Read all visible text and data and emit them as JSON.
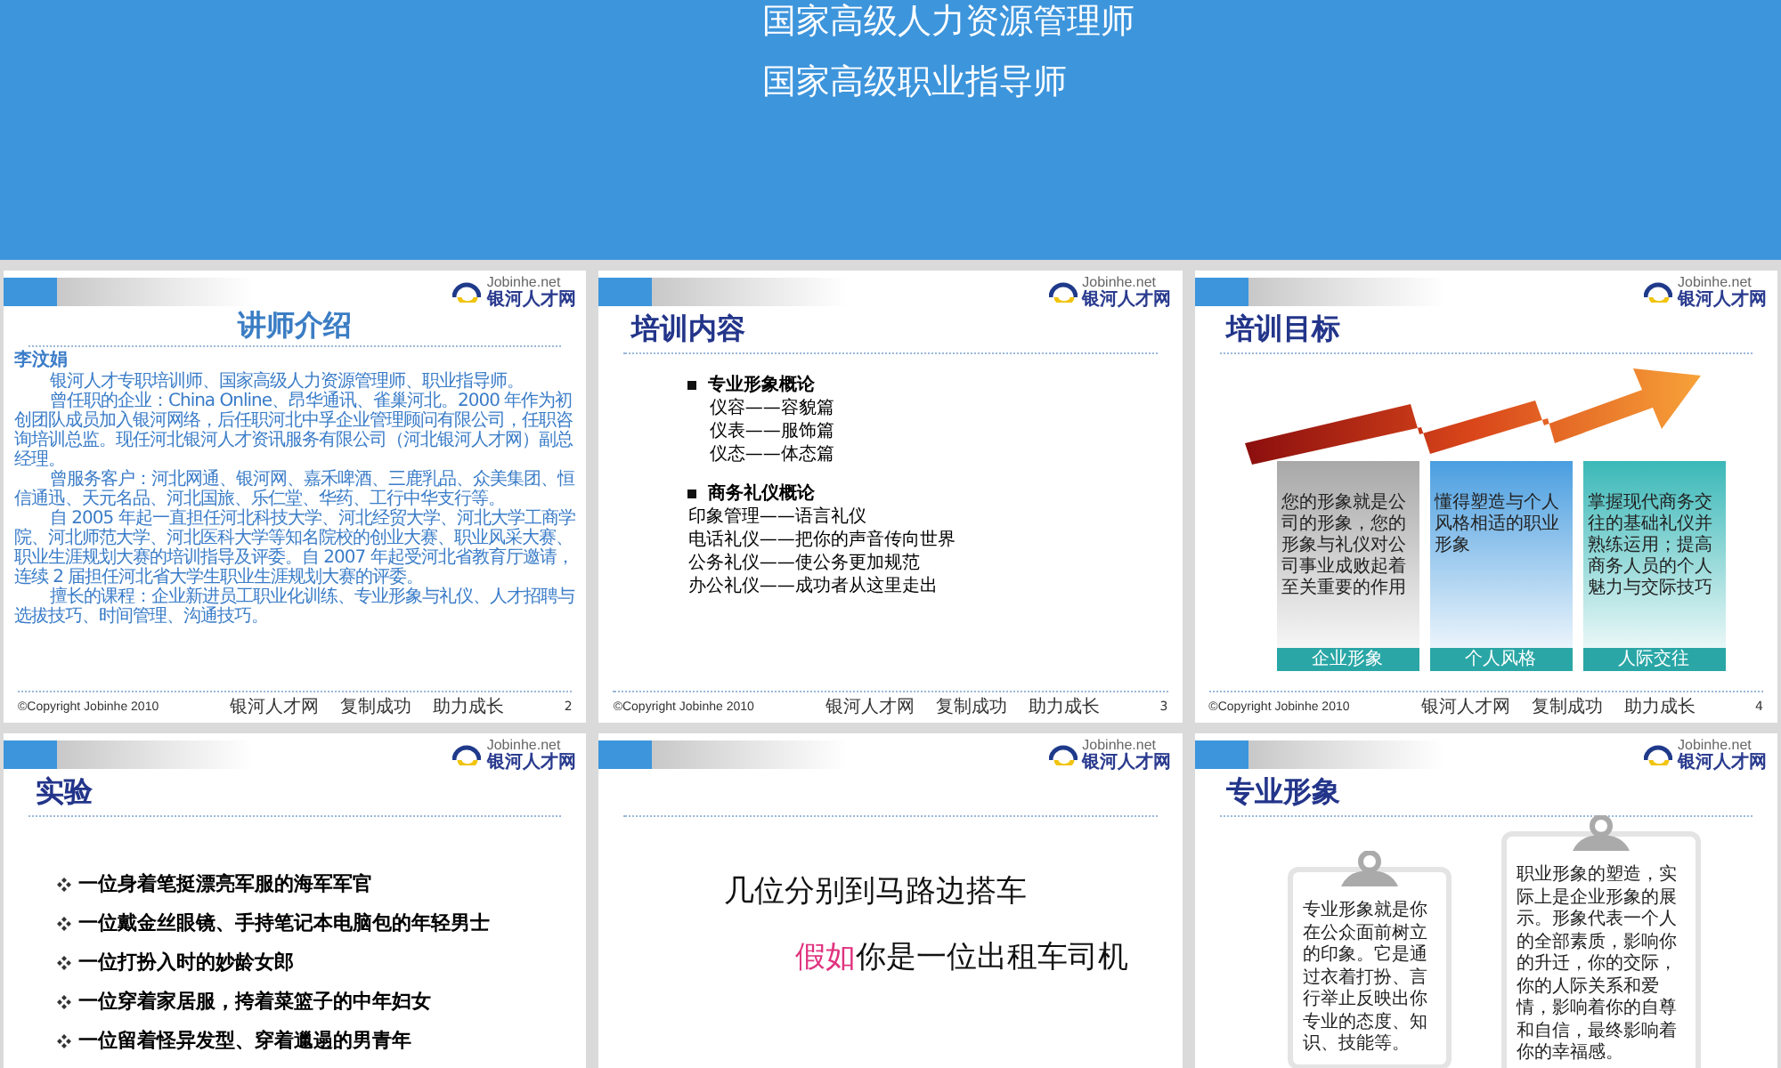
{
  "top_slide": {
    "lines": [
      "国家高级人力资源管理师",
      "国家高级职业指导师"
    ]
  },
  "slides": [
    {
      "kind": "bio",
      "title": "讲师介绍",
      "logo": {
        "brand": "Jobinhe.net",
        "name": "银河人才网"
      },
      "name": "李汶娟",
      "paragraphs": [
        "银河人才专职培训师、国家高级人力资源管理师、职业指导师。",
        "曾任职的企业：China Online、昂华通讯、雀巢河北。2000 年作为初创团队成员加入银河网络，后任职河北中孚企业管理顾问有限公司，任职咨询培训总监。现任河北银河人才资讯服务有限公司（河北银河人才网）副总经理。",
        "曾服务客户：河北网通、银河网、嘉禾啤酒、三鹿乳品、众美集团、恒信通迅、天元名品、河北国旅、乐仁堂、华药、工行中华支行等。",
        "自 2005 年起一直担任河北科技大学、河北经贸大学、河北大学工商学院、河北师范大学、河北医科大学等知名院校的创业大赛、职业风采大赛、职业生涯规划大赛的培训指导及评委。自 2007 年起受河北省教育厅邀请，连续 2 届担任河北省大学生职业生涯规划大赛的评委。",
        "擅长的课程：企业新进员工职业化训练、专业形象与礼仪、人才招聘与选拔技巧、时间管理、沟通技巧。"
      ],
      "footer": {
        "copyright": "©Copyright  Jobinhe  2010",
        "slogans": [
          "银河人才网",
          "复制成功",
          "助力成长"
        ],
        "page": "2"
      }
    },
    {
      "kind": "outline",
      "title": "培训内容",
      "logo": {
        "brand": "Jobinhe.net",
        "name": "银河人才网"
      },
      "sections": [
        {
          "heading": "专业形象概论",
          "items": [
            "仪容——容貌篇",
            "仪表——服饰篇",
            "仪态——体态篇"
          ]
        },
        {
          "heading": "商务礼仪概论",
          "items": [
            "印象管理——语言礼仪",
            "电话礼仪——把你的声音传向世界",
            "公务礼仪——使公务更加规范",
            "办公礼仪——成功者从这里走出"
          ]
        }
      ],
      "footer": {
        "copyright": "©Copyright  Jobinhe  2010",
        "slogans": [
          "银河人才网",
          "复制成功",
          "助力成长"
        ],
        "page": "3"
      }
    },
    {
      "kind": "goals",
      "title": "培训目标",
      "logo": {
        "brand": "Jobinhe.net",
        "name": "银河人才网"
      },
      "panels": [
        {
          "text": "您的形象就是公司的形象，您的形象与礼仪对公司事业成败起着至关重要的作用",
          "label": "企业形象"
        },
        {
          "text": "懂得塑造与个人风格相适的职业形象",
          "label": "个人风格"
        },
        {
          "text": "掌握现代商务交往的基础礼仪并熟练运用；提高商务人员的个人魅力与交际技巧",
          "label": "人际交往"
        }
      ],
      "footer": {
        "copyright": "©Copyright  Jobinhe  2010",
        "slogans": [
          "银河人才网",
          "复制成功",
          "助力成长"
        ],
        "page": "4"
      }
    },
    {
      "kind": "bullets",
      "title": "实验",
      "logo": {
        "brand": "Jobinhe.net",
        "name": "银河人才网"
      },
      "items": [
        "一位身着笔挺漂亮军服的海军军官",
        "一位戴金丝眼镜、手持笔记本电脑包的年轻男士",
        "一位打扮入时的妙龄女郎",
        "一位穿着家居服，挎着菜篮子的中年妇女",
        "一位留着怪异发型、穿着邋遢的男青年"
      ]
    },
    {
      "kind": "statement",
      "logo": {
        "brand": "Jobinhe.net",
        "name": "银河人才网"
      },
      "line1": "几位分别到马路边搭车",
      "highlight": "假如",
      "line2": "你是一位出租车司机"
    },
    {
      "kind": "clipboards",
      "title": "专业形象",
      "logo": {
        "brand": "Jobinhe.net",
        "name": "银河人才网"
      },
      "cards": [
        "专业形象就是你在公众面前树立的印象。它是通过衣着打扮、言行举止反映出你专业的态度、知识、技能等。",
        "职业形象的塑造，实际上是企业形象的展示。形象代表一个人的全部素质，影响你的升迁，你的交际，你的人际关系和爱情，影响着你的自尊和自信，最终影响着你的幸福感。"
      ]
    }
  ]
}
